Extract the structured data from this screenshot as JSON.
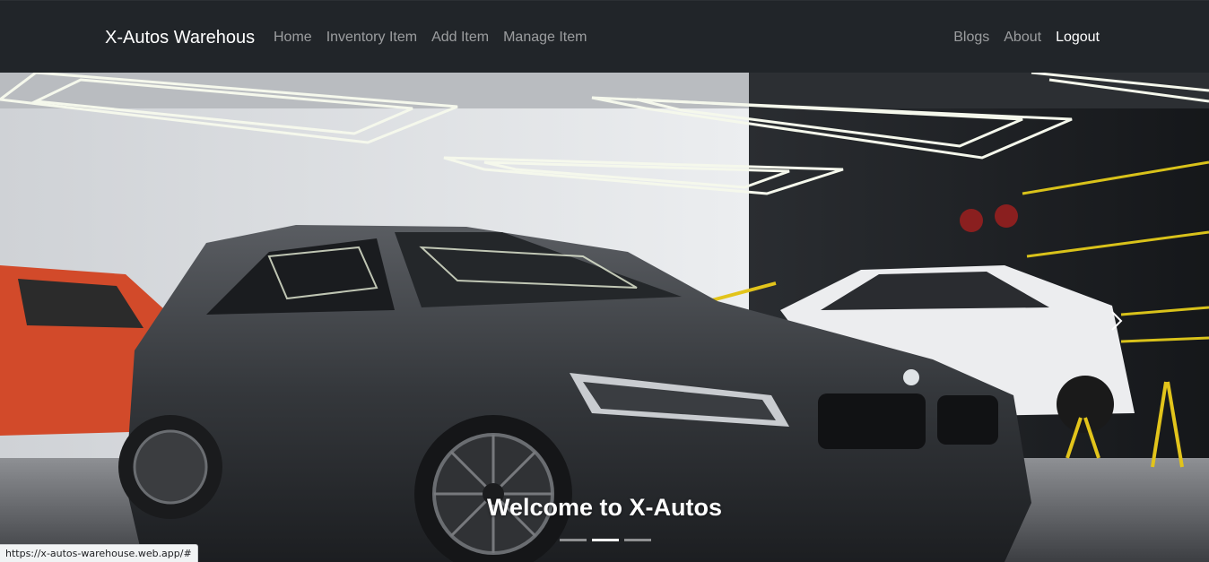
{
  "navbar": {
    "brand": "X-Autos Warehous",
    "left_links": [
      "Home",
      "Inventory Item",
      "Add Item",
      "Manage Item"
    ],
    "right_links": [
      "Blogs",
      "About"
    ],
    "logout": "Logout"
  },
  "hero": {
    "caption": "Welcome to X-Autos",
    "slides_count": 3,
    "active_slide": 2,
    "next_icon": "chevron-right-icon"
  },
  "status_bar": {
    "url": "https://x-autos-warehouse.web.app/#"
  }
}
